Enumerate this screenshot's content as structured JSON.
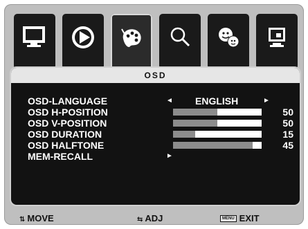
{
  "tabs": [
    {
      "icon": "monitor-icon",
      "active": false
    },
    {
      "icon": "play-circle-icon",
      "active": false
    },
    {
      "icon": "palette-icon",
      "active": true
    },
    {
      "icon": "magnifier-icon",
      "active": false
    },
    {
      "icon": "faces-icon",
      "active": false
    },
    {
      "icon": "display-info-icon",
      "active": false
    }
  ],
  "panel": {
    "title": "OSD"
  },
  "rows": {
    "language": {
      "label": "OSD-LANGUAGE",
      "left_arrow": "◄",
      "value": "ENGLISH",
      "right_arrow": "►"
    },
    "h_position": {
      "label": "OSD H-POSITION",
      "value": "50",
      "fill": 0.5
    },
    "v_position": {
      "label": "OSD V-POSITION",
      "value": "50",
      "fill": 0.5
    },
    "duration": {
      "label": "OSD DURATION",
      "value": "15",
      "fill": 0.25
    },
    "halftone": {
      "label": "OSD HALFTONE",
      "value": "45",
      "fill": 0.9
    },
    "mem_recall": {
      "label": "MEM-RECALL",
      "arrow": "►"
    }
  },
  "footer": {
    "move_glyph": "⇅",
    "move_label": "MOVE",
    "adj_glyph": "⇆",
    "adj_label": "ADJ",
    "menu_chip": "MENU",
    "exit_label": "EXIT"
  },
  "colors": {
    "bar_fill": "#8c8c8c",
    "bar_track": "#ffffff",
    "panel_bg": "#121212",
    "frame_bg": "#bfbfbf"
  }
}
